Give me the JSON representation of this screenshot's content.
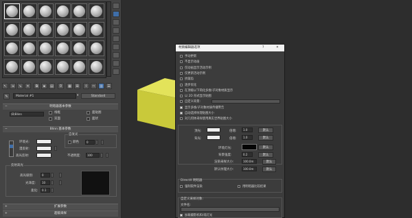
{
  "material_editor": {
    "name_field": "Material #1",
    "type_button": "Standard",
    "shader_rollout": {
      "title": "明暗器基本参数",
      "shader_select": "(B)Blinn",
      "checks": [
        "线框",
        "双面",
        "面贴图",
        "面状"
      ]
    },
    "blinn_rollout": {
      "title": "Blinn 基本参数",
      "self_illum_group": "自发光",
      "color_label": "颜色",
      "color_value": "0",
      "ambient_label": "环境光:",
      "diffuse_label": "漫反射:",
      "specular_label": "高光反射:",
      "opacity_label": "不透明度:",
      "opacity_value": "100",
      "reflect_group": "反射高光",
      "spec_level_label": "高光级别:",
      "spec_level_value": "0",
      "gloss_label": "光泽度:",
      "gloss_value": "10",
      "soften_label": "柔化:",
      "soften_value": "0.1"
    },
    "extended_rollout": "扩展参数",
    "supersampling_rollout": "超级采样"
  },
  "dialog": {
    "title": "材质编辑器选项",
    "help": "?",
    "close": "✕",
    "options": [
      {
        "label": "手动更新",
        "checked": false
      },
      {
        "label": "不显示动画",
        "checked": false
      },
      {
        "label": "仅动画显示活动示例",
        "checked": false
      },
      {
        "label": "仅更新活动示例",
        "checked": false
      },
      {
        "label": "抗锯齿",
        "checked": false
      },
      {
        "label": "逐步优化",
        "checked": false
      },
      {
        "label": "在顶级以下简化多维/子对象材质显示",
        "checked": false
      },
      {
        "label": "以 2D 形式显示贴图",
        "checked": false
      },
      {
        "label": "自定义背景:",
        "checked": false
      },
      {
        "label": "显示多维/子对象材质传播警告",
        "checked": true
      },
      {
        "label": "自动选择纹理贴图大小",
        "checked": true
      },
      {
        "label": "对几何体采样使用真实世界贴图大小",
        "checked": false
      }
    ],
    "top_light": {
      "label": "顶光:",
      "mult_label": "倍增:",
      "mult_value": "1.0",
      "default_btn": "默认"
    },
    "back_light": {
      "label": "背光:",
      "mult_label": "倍增:",
      "mult_value": "1.0",
      "default_btn": "默认"
    },
    "ambient": {
      "label": "环境灯光:",
      "default_btn": "默认"
    },
    "bg_intensity": {
      "label": "背景强度:",
      "value": "0.2",
      "default_btn": "默认"
    },
    "render_size": {
      "label": "渲染采样大小:",
      "value": "100.0m",
      "default_btn": "默认"
    },
    "tex_size": {
      "label": "默认纹理大小:",
      "value": "100.0m",
      "default_btn": "默认"
    },
    "directx": {
      "title": "DirectX 明暗器",
      "force_software": "强制软件渲染",
      "compare_results": "用明暗器比较结果"
    },
    "custom_sample": {
      "title": "自定义采样对象:",
      "file_label": "文件名:",
      "load_camera": "加载摄影机和/或灯光"
    }
  },
  "colors": {
    "cube_face": "#c9c93a",
    "cube_top": "#e3e35a",
    "cube_side": "#9c9c28",
    "active_tool": "#3f6ea8"
  }
}
